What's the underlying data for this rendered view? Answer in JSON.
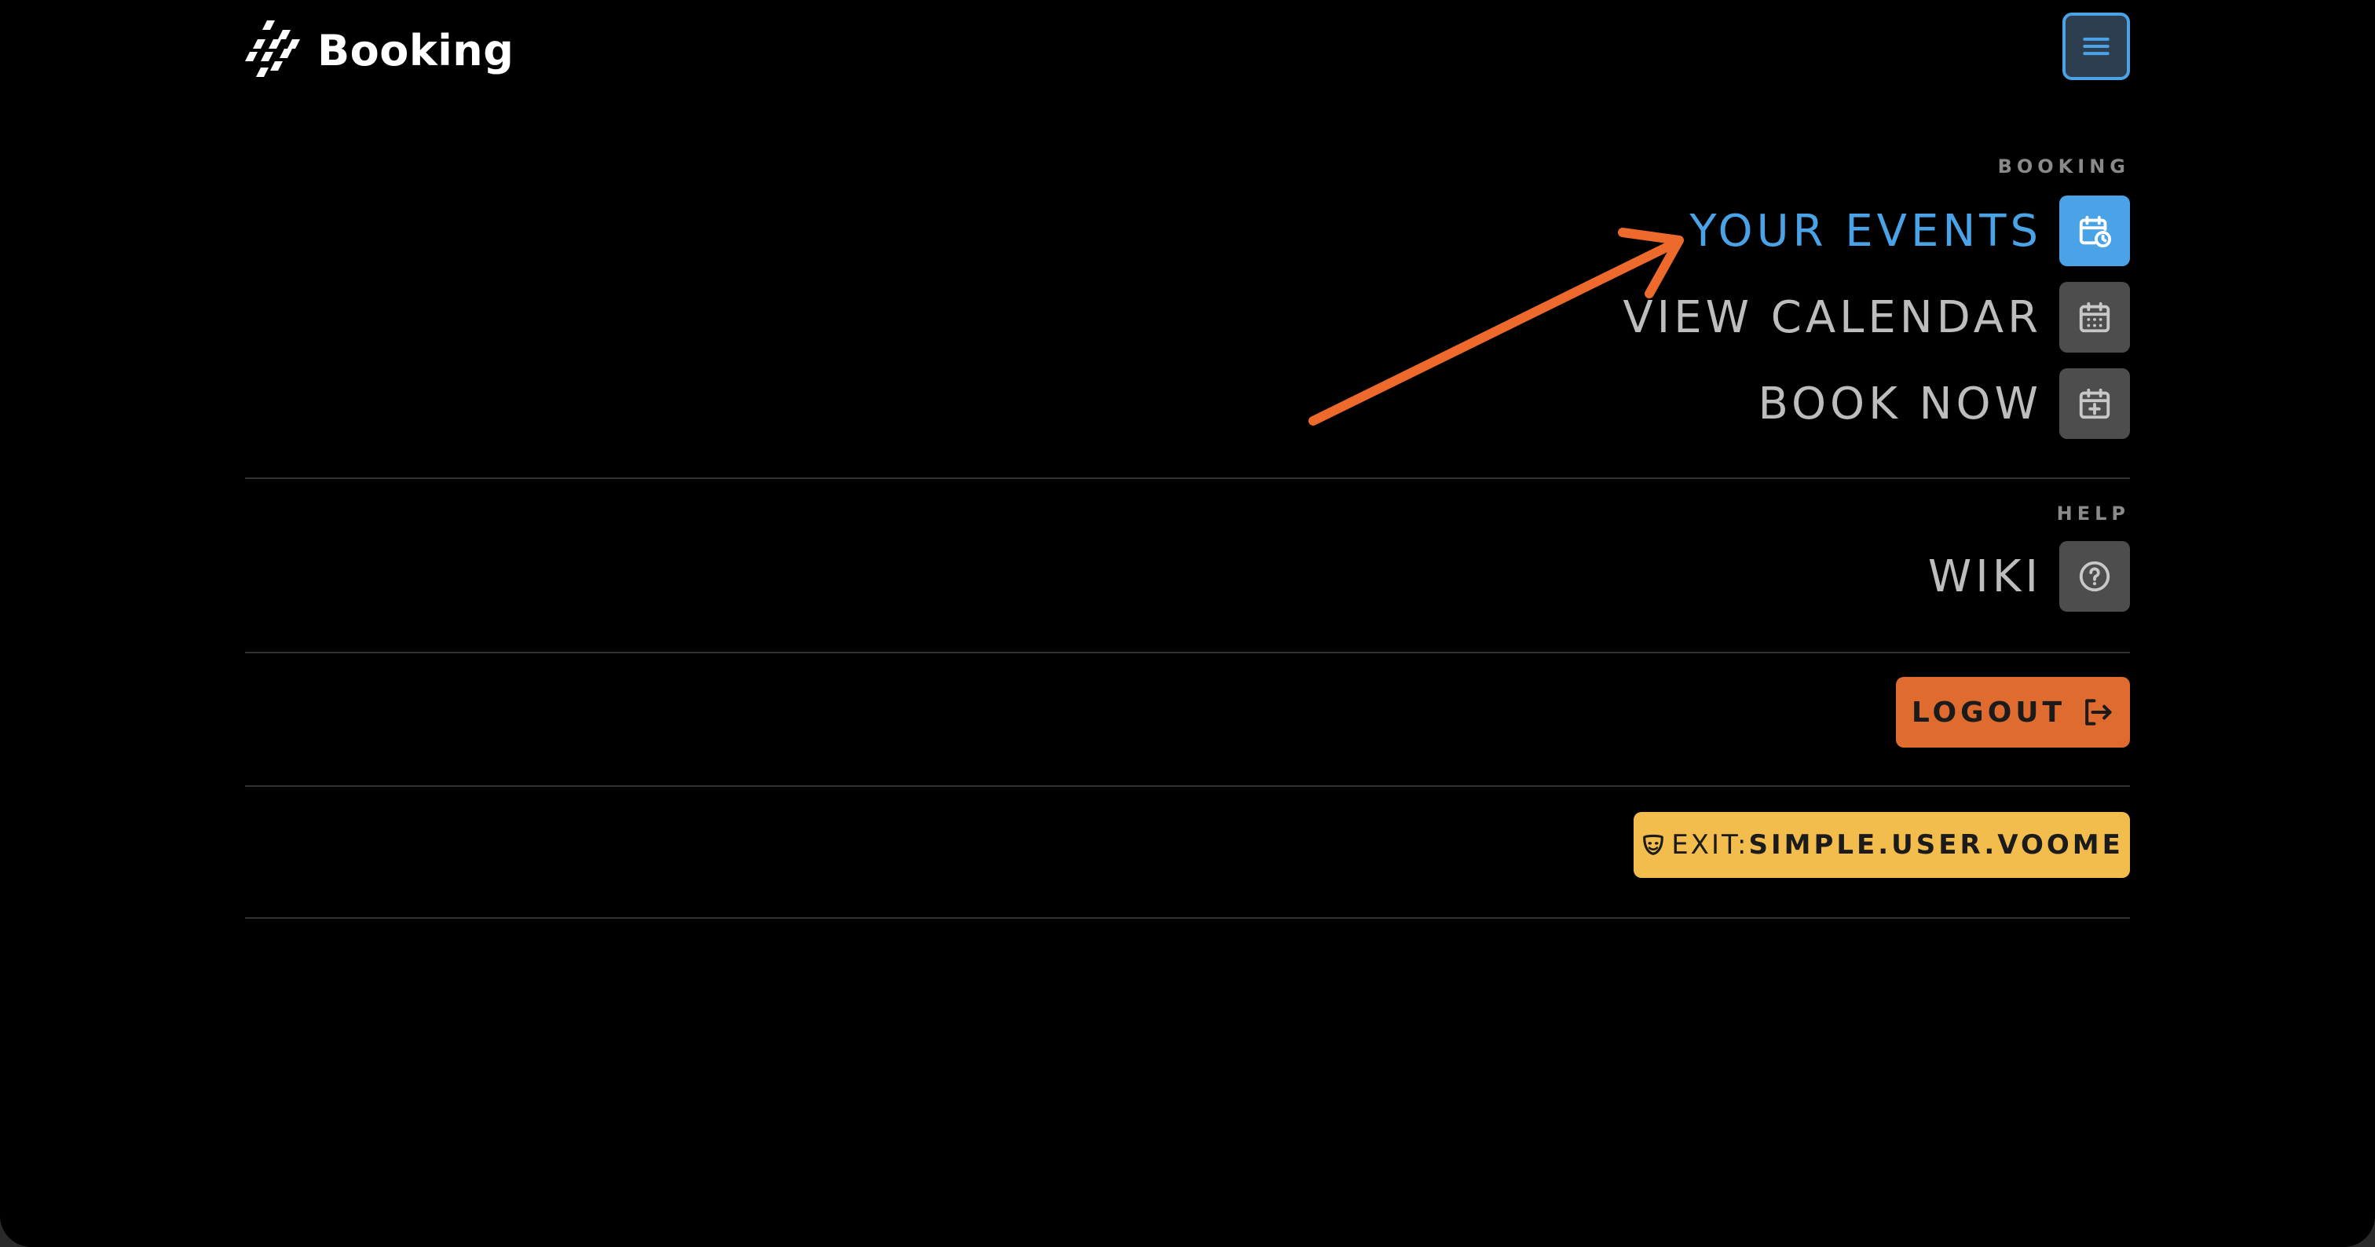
{
  "header": {
    "brand_name": "Booking",
    "menu_icon": "hamburger-menu-icon"
  },
  "booking_section": {
    "label": "BOOKING",
    "items": [
      {
        "label": "YOUR EVENTS",
        "icon": "calendar-clock-icon",
        "active": true
      },
      {
        "label": "VIEW CALENDAR",
        "icon": "calendar-grid-icon",
        "active": false
      },
      {
        "label": "BOOK NOW",
        "icon": "calendar-plus-icon",
        "active": false
      }
    ]
  },
  "help_section": {
    "label": "HELP",
    "items": [
      {
        "label": "WIKI",
        "icon": "question-circle-icon",
        "active": false
      }
    ]
  },
  "logout": {
    "label": "LOGOUT",
    "icon": "logout-icon"
  },
  "impersonation": {
    "prefix": "EXIT:",
    "user": "SIMPLE.USER.VOOME",
    "icon": "mask-icon"
  },
  "colors": {
    "background": "#000000",
    "accent_blue": "#4aa3e6",
    "logout_orange": "#e06b2f",
    "exit_yellow": "#f2bd4c",
    "inactive_icon_bg": "#4d4d4d",
    "annotation_arrow": "#ee6a2c"
  }
}
